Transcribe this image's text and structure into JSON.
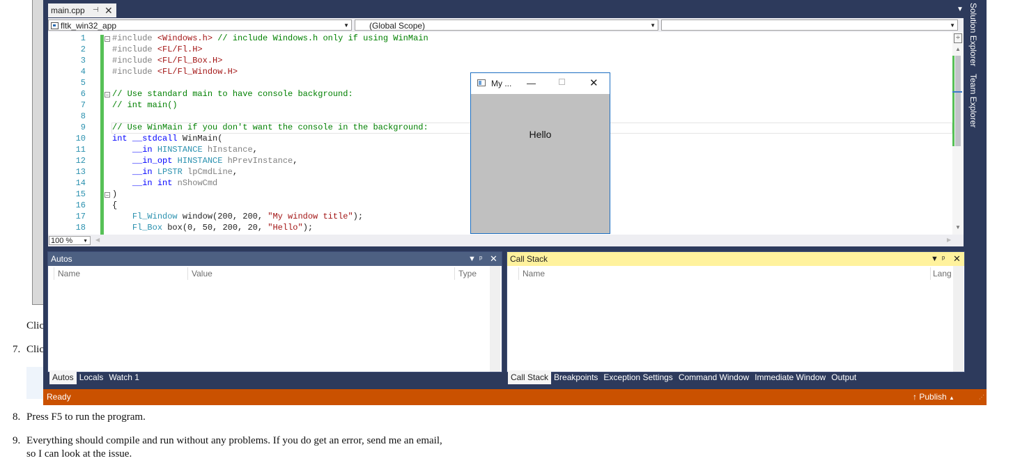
{
  "doc": {
    "frag1": "Clic",
    "frag2_num": "7.",
    "frag2": "Clic",
    "step8_num": "8.",
    "step8": "Press F5 to run the program.",
    "step9_num": "9.",
    "step9_line1": "Everything should compile and run without any problems. If you do get an error, send me an email,",
    "step9_line2": "so I can look at the issue."
  },
  "ide": {
    "tab": {
      "label": "main.cpp",
      "pin": "⊣",
      "close": "✕"
    },
    "nav": {
      "project": "fltk_win32_app",
      "scope": "(Global Scope)",
      "member": ""
    },
    "editor": {
      "line_numbers": [
        "1",
        "2",
        "3",
        "4",
        "5",
        "6",
        "7",
        "8",
        "9",
        "10",
        "11",
        "12",
        "13",
        "14",
        "15",
        "16",
        "17",
        "18"
      ],
      "zoom": "100 %"
    },
    "side_tabs": [
      "Solution Explorer",
      "Team Explorer"
    ],
    "autos": {
      "title": "Autos",
      "columns": [
        "Name",
        "Value",
        "Type"
      ],
      "tabs": [
        "Autos",
        "Locals",
        "Watch 1"
      ],
      "active_tab": "Autos"
    },
    "callstack": {
      "title": "Call Stack",
      "columns": [
        "Name",
        "Lang"
      ],
      "tabs": [
        "Call Stack",
        "Breakpoints",
        "Exception Settings",
        "Command Window",
        "Immediate Window",
        "Output"
      ],
      "active_tab": "Call Stack"
    },
    "status": {
      "text": "Ready",
      "publish": "Publish"
    },
    "colors": {
      "status_bar": "#ca5100",
      "callstack_title": "#fff29d",
      "frame": "#2d3a5c",
      "change_bar": "#57c157"
    }
  },
  "fltk_window": {
    "title": "My ...",
    "label": "Hello"
  }
}
